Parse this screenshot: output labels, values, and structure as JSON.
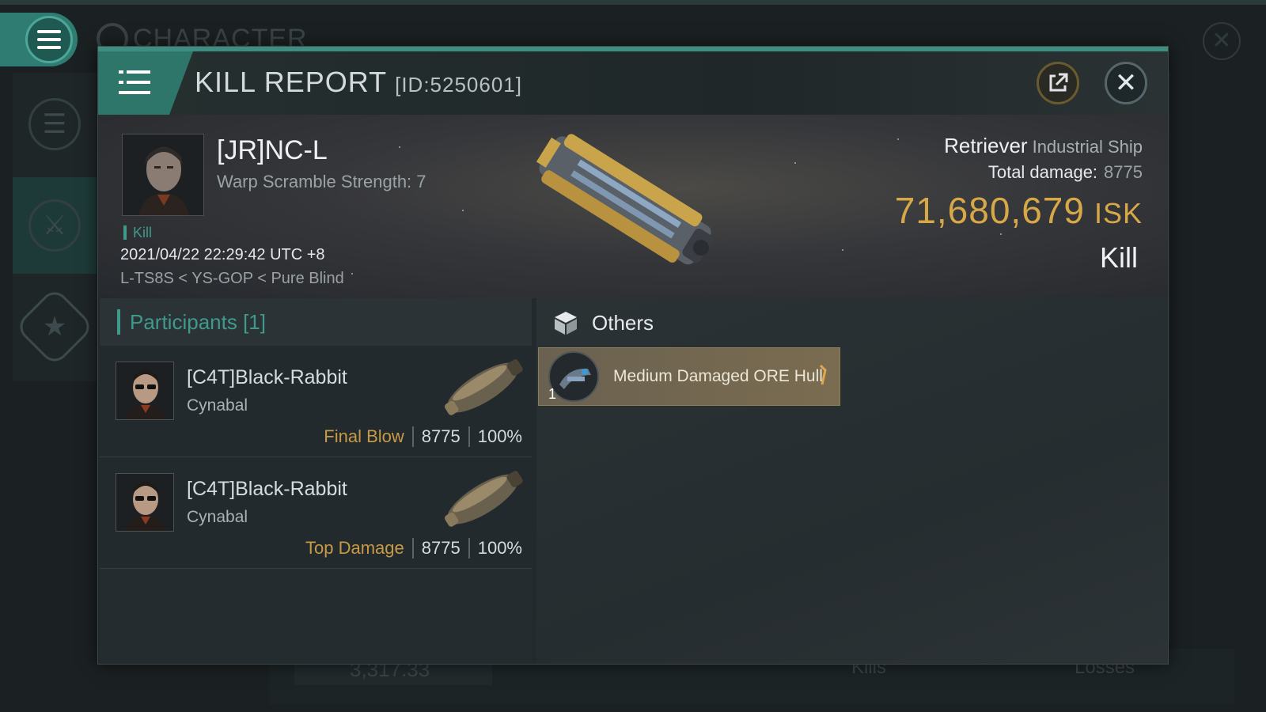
{
  "background": {
    "title": "CHARACTER",
    "bottom_stat": "3,317.33",
    "kills_label": "Kills",
    "losses_label": "Losses"
  },
  "kill_report": {
    "title": "KILL REPORT",
    "id": "[ID:5250601]",
    "victim": {
      "name": "[JR]NC-L",
      "warp_scramble": "Warp Scramble Strength: 7",
      "tag": "Kill",
      "datetime": "2021/04/22 22:29:42 UTC +8",
      "location": "L-TS8S < YS-GOP < Pure Blind"
    },
    "ship": {
      "name": "Retriever",
      "class": "Industrial Ship",
      "total_damage_label": "Total damage:",
      "total_damage": "8775",
      "isk_value": "71,680,679",
      "isk_unit": "ISK",
      "result": "Kill"
    },
    "participants": {
      "header": "Participants [1]",
      "rows": [
        {
          "name": "[C4T]Black-Rabbit",
          "ship": "Cynabal",
          "role": "Final Blow",
          "damage": "8775",
          "percent": "100%"
        },
        {
          "name": "[C4T]Black-Rabbit",
          "ship": "Cynabal",
          "role": "Top Damage",
          "damage": "8775",
          "percent": "100%"
        }
      ]
    },
    "others": {
      "header": "Others",
      "items": [
        {
          "name": "Medium Damaged ORE Hull",
          "qty": "1"
        }
      ]
    }
  },
  "colors": {
    "accent": "#3f9a8c",
    "isk_gold": "#d7a848",
    "role_gold": "#c89a45",
    "item_bg": "#7a6c50"
  },
  "icons": [
    "menu-icon",
    "gear-icon",
    "close-icon",
    "share-icon",
    "crossed-swords-icon",
    "star-icon",
    "cube-icon"
  ]
}
